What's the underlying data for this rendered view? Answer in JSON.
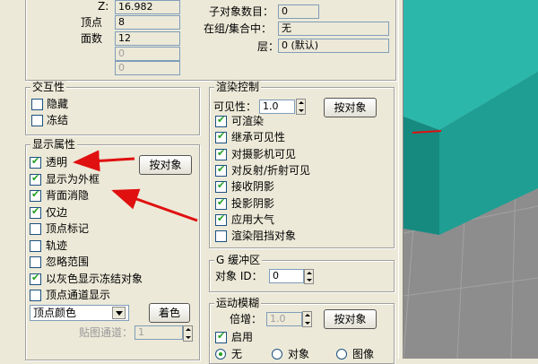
{
  "top": {
    "z_label": "Z:",
    "z_value": "16.982",
    "vertices_label": "顶点",
    "vertices_value": "8",
    "faces_label": "面数",
    "faces_value": "12",
    "blank1": "0",
    "blank2": "0",
    "children_label": "子对象数目：",
    "children_value": "0",
    "group_label": "在组/集合中：",
    "group_value": "无",
    "layer_label": "层：",
    "layer_value": "0 (默认)"
  },
  "interactivity": {
    "title": "交互性",
    "hide": "隐藏",
    "freeze": "冻结"
  },
  "display": {
    "title": "显示属性",
    "by_object_button": "按对象",
    "items": [
      {
        "label": "透明",
        "checked": true
      },
      {
        "label": "显示为外框",
        "checked": true
      },
      {
        "label": "背面消隐",
        "checked": true
      },
      {
        "label": "仅边",
        "checked": true
      },
      {
        "label": "顶点标记",
        "checked": false
      },
      {
        "label": "轨迹",
        "checked": false
      },
      {
        "label": "忽略范围",
        "checked": false
      },
      {
        "label": "以灰色显示冻结对象",
        "checked": true
      },
      {
        "label": "顶点通道显示",
        "checked": false
      }
    ],
    "vertex_color_value": "顶点颜色",
    "shade_button": "着色",
    "map_channel_label": "贴图通道：",
    "map_channel_value": "1"
  },
  "render": {
    "title": "渲染控制",
    "visibility_label": "可见性：",
    "visibility_value": "1.0",
    "by_object_button": "按对象",
    "items": [
      {
        "label": "可渲染",
        "checked": true
      },
      {
        "label": "继承可见性",
        "checked": true
      },
      {
        "label": "对摄影机可见",
        "checked": true
      },
      {
        "label": "对反射/折射可见",
        "checked": true
      },
      {
        "label": "接收阴影",
        "checked": true
      },
      {
        "label": "投影阴影",
        "checked": true
      },
      {
        "label": "应用大气",
        "checked": true
      },
      {
        "label": "渲染阻挡对象",
        "checked": false
      }
    ]
  },
  "gbuffer": {
    "title": "G 缓冲区",
    "object_id_label": "对象 ID：",
    "object_id_value": "0"
  },
  "motion_blur": {
    "title": "运动模糊",
    "multiplier_label": "倍增：",
    "multiplier_value": "1.0",
    "by_object_button": "按对象",
    "enable_label": "启用",
    "options": [
      "无",
      "对象",
      "图像"
    ]
  },
  "colors": {
    "panel_bg": "#ece9d8",
    "box_front": "#1f9e93",
    "box_top": "#2bb8aa",
    "arrow": "#e01010",
    "check": "#21a121"
  }
}
